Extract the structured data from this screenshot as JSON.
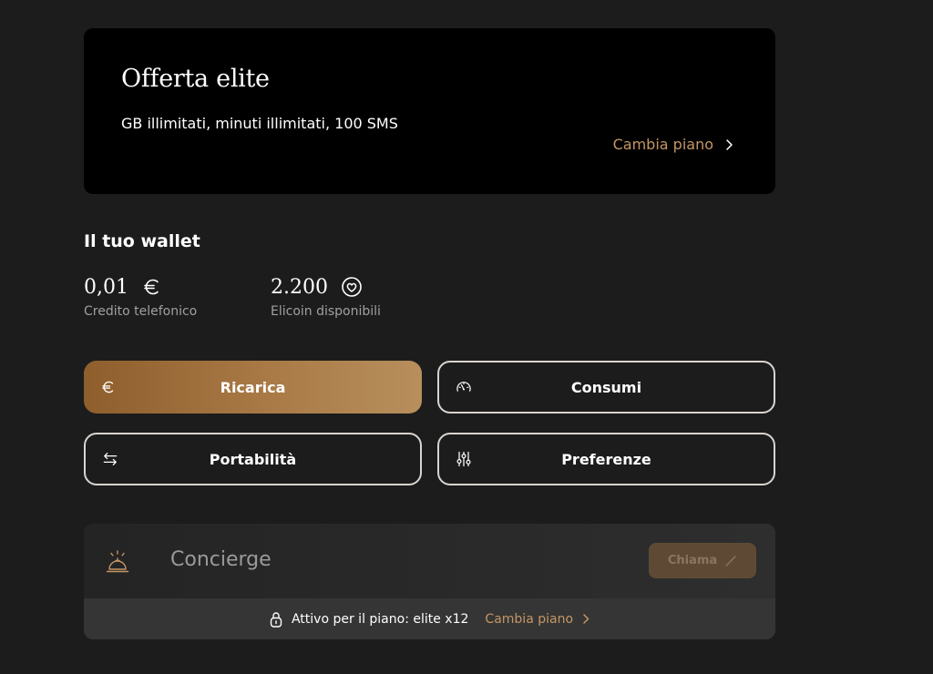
{
  "plan": {
    "title": "Offerta elite",
    "description": "GB illimitati, minuti illimitati, 100 SMS",
    "change_label": "Cambia piano"
  },
  "wallet": {
    "title": "Il tuo wallet",
    "credit": {
      "value": "0,01",
      "label": "Credito telefonico",
      "icon": "euro-icon"
    },
    "coins": {
      "value": "2.200",
      "label": "Elicoin disponibili",
      "icon": "elicoin-icon"
    }
  },
  "actions": {
    "recharge": "Ricarica",
    "usage": "Consumi",
    "portability": "Portabilità",
    "preferences": "Preferenze"
  },
  "concierge": {
    "label": "Concierge",
    "call_label": "Chiama",
    "active_text": "Attivo per il piano: elite x12",
    "change_label": "Cambia piano"
  },
  "colors": {
    "background": "#1c1c1c",
    "accent_gold": "#c49666",
    "card_black": "#000000"
  }
}
